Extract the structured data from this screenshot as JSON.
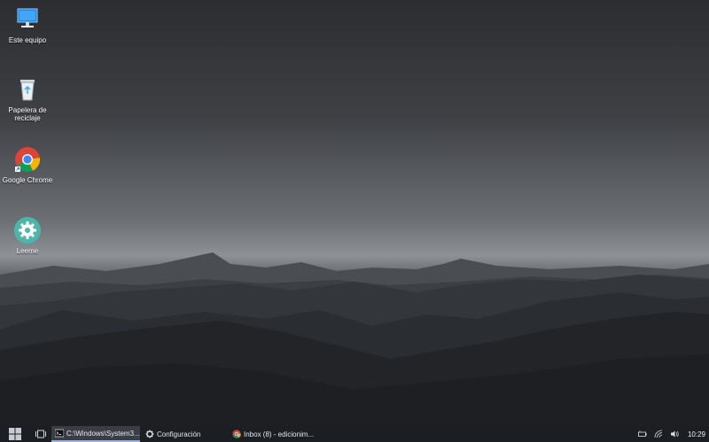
{
  "desktop": {
    "icons": [
      {
        "label": "Este equipo",
        "icon": "computer-icon"
      },
      {
        "label": "Papelera de reciclaje",
        "icon": "recycle-bin-icon"
      },
      {
        "label": "Google Chrome",
        "icon": "chrome-icon"
      },
      {
        "label": "Leeme",
        "icon": "gear-icon"
      }
    ]
  },
  "taskbar": {
    "start_icon": "windows-start-icon",
    "taskview_icon": "task-view-icon",
    "items": [
      {
        "label": "C:\\Windows\\System3...",
        "icon": "cmd-icon",
        "active": true
      },
      {
        "label": "Configuración",
        "icon": "settings-gear-icon",
        "active": false
      },
      {
        "label": "Inbox (8) - edicionim...",
        "icon": "chrome-icon",
        "active": false
      }
    ],
    "tray": {
      "icons": [
        "battery-icon",
        "wifi-icon",
        "volume-icon"
      ],
      "time": "10:29"
    }
  },
  "colors": {
    "taskbar_bg": "#1b1e22",
    "active_task_bg": "#3a3e44",
    "accent": "#8ab4f8"
  }
}
